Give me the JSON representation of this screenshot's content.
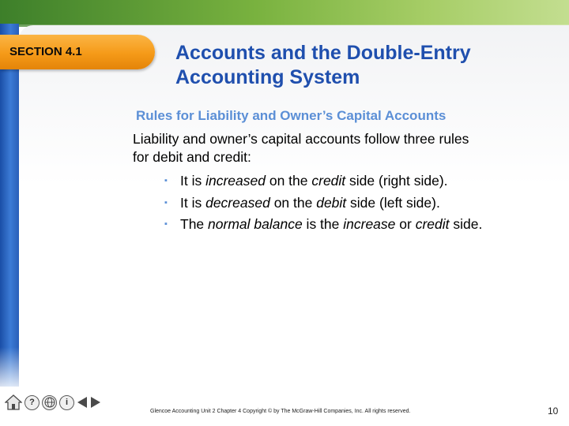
{
  "section": {
    "label": "SECTION 4.1"
  },
  "title": {
    "line1": "Accounts and the Double-Entry",
    "line2": "Accounting System"
  },
  "subtitle": "Rules for Liability and Owner’s Capital Accounts",
  "body": {
    "line1": "Liability and owner’s capital accounts follow three rules",
    "line2": "for debit and credit:"
  },
  "bullets": [
    {
      "t1": "It is ",
      "t2": "increased",
      "t3": " on the ",
      "t4": "credit",
      "t5": " side (right side)."
    },
    {
      "t1": "It is ",
      "t2": "decreased",
      "t3": " on the ",
      "t4": "debit",
      "t5": " side (left side)."
    },
    {
      "t1": "The  ",
      "t2": "normal balance",
      "t3": " is the ",
      "t4": "increase",
      "t5": " or ",
      "t6": "credit",
      "t7": " side."
    }
  ],
  "toolbar": {
    "help_glyph": "?",
    "info_glyph": "i",
    "icons": [
      "home-icon",
      "help-icon",
      "globe-icon",
      "info-icon",
      "previous-arrow-icon",
      "next-arrow-icon"
    ]
  },
  "footer": "Glencoe Accounting  Unit 2 Chapter 4   Copyright © by The McGraw-Hill Companies, Inc. All rights reserved.",
  "page_number": "10",
  "colors": {
    "title": "#1f4fae",
    "subtitle": "#5b8fd6",
    "tab": "#f59a18",
    "green_bar": "#79b23f",
    "blue_bar": "#2a5fb8"
  }
}
